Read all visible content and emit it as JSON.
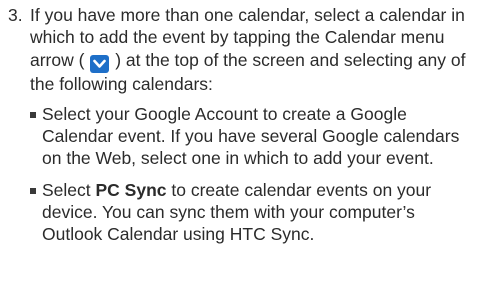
{
  "step": {
    "number": "3.",
    "text_before_icon": "If you have more than one calendar, select a calendar in which to add the event by tapping the Calendar menu arrow (",
    "icon": "chevron-down-icon",
    "text_after_icon": ") at the top of the screen and selecting any of the following calendars:"
  },
  "bullets": [
    {
      "text": "Select your Google Account to create a Google Calendar event. If you have several Google calendars on the Web, select one in which to add your event."
    },
    {
      "prefix": "Select ",
      "bold": "PC Sync",
      "text": " to create calendar events on your device. You can sync them with your computer’s Outlook Calendar using HTC Sync."
    }
  ],
  "colors": {
    "icon_background": "#1e6fc8",
    "text": "#2b2b2b"
  }
}
